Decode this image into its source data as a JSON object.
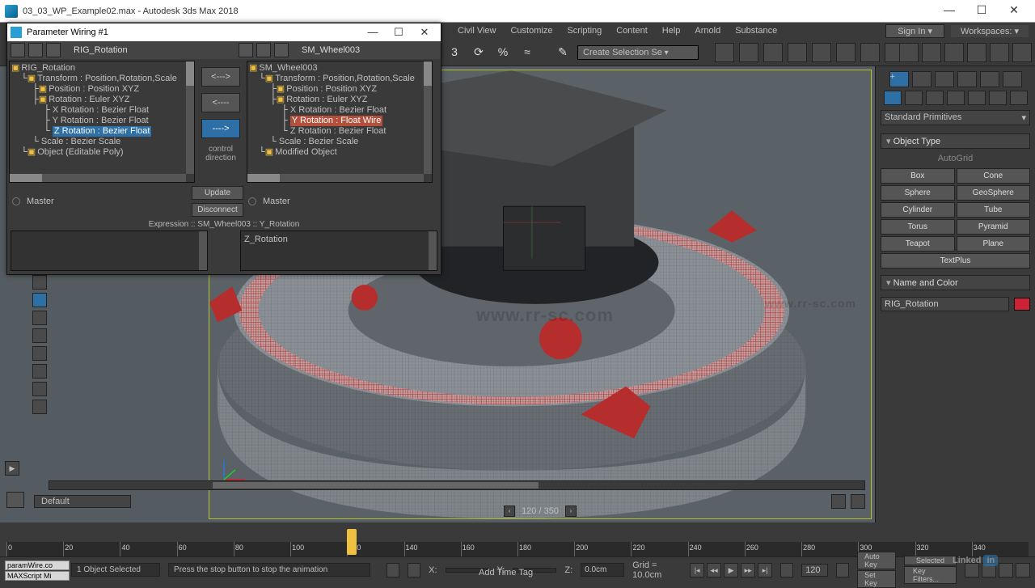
{
  "window": {
    "title": "03_03_WP_Example02.max - Autodesk 3ds Max 2018",
    "minimize": "—",
    "maximize": "☐",
    "close": "✕"
  },
  "menus": [
    "Civil View",
    "Customize",
    "Scripting",
    "Content",
    "Help",
    "Arnold",
    "Substance"
  ],
  "signin": "Sign In",
  "workspaces": "Workspaces:",
  "selection_set": "Create Selection Se",
  "param_wiring": {
    "title": "Parameter Wiring #1",
    "left_name": "RIG_Rotation",
    "right_name": "SM_Wheel003",
    "left_tree": {
      "root": "RIG_Rotation",
      "transform": "Transform : Position,Rotation,Scale",
      "pos": "Position : Position XYZ",
      "rot": "Rotation : Euler XYZ",
      "xr": "X Rotation : Bezier Float",
      "yr": "Y Rotation : Bezier Float",
      "zr": "Z Rotation : Bezier Float",
      "scale": "Scale : Bezier Scale",
      "obj": "Object (Editable Poly)"
    },
    "right_tree": {
      "root": "SM_Wheel003",
      "transform": "Transform : Position,Rotation,Scale",
      "pos": "Position : Position XYZ",
      "rot": "Rotation : Euler XYZ",
      "xr": "X Rotation : Bezier Float",
      "yr": "Y Rotation : Float Wire",
      "zr": "Z Rotation : Bezier Float",
      "scale": "Scale : Bezier Scale",
      "mod": "Modified Object"
    },
    "arrows": {
      "two": "<--->",
      "left": "<----",
      "right": "---->"
    },
    "control_direction": "control\ndirection",
    "master": "Master",
    "update": "Update",
    "disconnect": "Disconnect",
    "expr_header": "Expression :: SM_Wheel003 :: Y_Rotation",
    "expr_text": "Z_Rotation"
  },
  "viewport": {
    "range": "120 / 350",
    "watermark": "www.rr-sc.com"
  },
  "command_panel": {
    "dropdown": "Standard Primitives",
    "object_type": "Object Type",
    "autogrid": "AutoGrid",
    "primitives": [
      "Box",
      "Cone",
      "Sphere",
      "GeoSphere",
      "Cylinder",
      "Tube",
      "Torus",
      "Pyramid",
      "Teapot",
      "Plane",
      "TextPlus"
    ],
    "name_and_color": "Name and Color",
    "name_value": "RIG_Rotation"
  },
  "timeline": {
    "ticks": [
      0,
      20,
      40,
      60,
      80,
      100,
      120,
      140,
      160,
      180,
      200,
      220,
      240,
      260,
      280,
      300,
      320,
      340
    ],
    "playhead_frame": 120
  },
  "status": {
    "maxscript1": "paramWire.co",
    "maxscript2": "MAXScript Mi",
    "selection": "1 Object Selected",
    "prompt": "Press the stop button to stop the animation",
    "x": "X:",
    "xv": "",
    "y": "Y:",
    "yv": "",
    "z": "Z:",
    "zv": "0.0cm",
    "grid": "Grid = 10.0cm",
    "addtimetag": "Add Time Tag",
    "frame": "120",
    "autokey": "Auto Key",
    "setkey": "Set Key",
    "selected": "Selected",
    "keyfilters": "Key Filters..."
  },
  "layer": {
    "default": "Default"
  },
  "logo": {
    "linked": "Linked",
    "in": "in"
  }
}
